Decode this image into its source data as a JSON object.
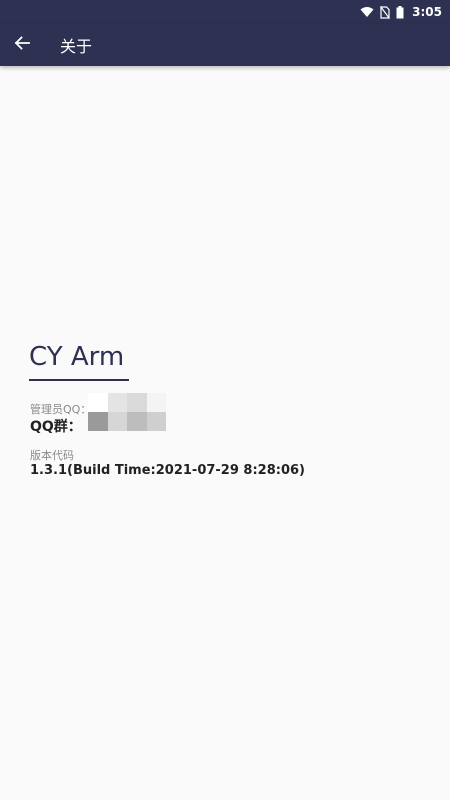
{
  "status_bar": {
    "time": "3:05",
    "icons": [
      "wifi-icon",
      "no-sim-icon",
      "battery-icon"
    ]
  },
  "toolbar": {
    "title": "关于",
    "back_icon": "arrow-back-icon"
  },
  "about": {
    "app_name": "CY Arm",
    "admin_qq_label": "管理员QQ：",
    "qq_group_label": "QQ群：",
    "version_label": "版本代码",
    "version_value": "1.3.1(Build Time:2021-07-29 8:28:06)"
  },
  "colors": {
    "primary": "#2e3152",
    "background": "#fafafa",
    "text_primary": "#222222",
    "text_secondary": "#8a8a8a"
  }
}
